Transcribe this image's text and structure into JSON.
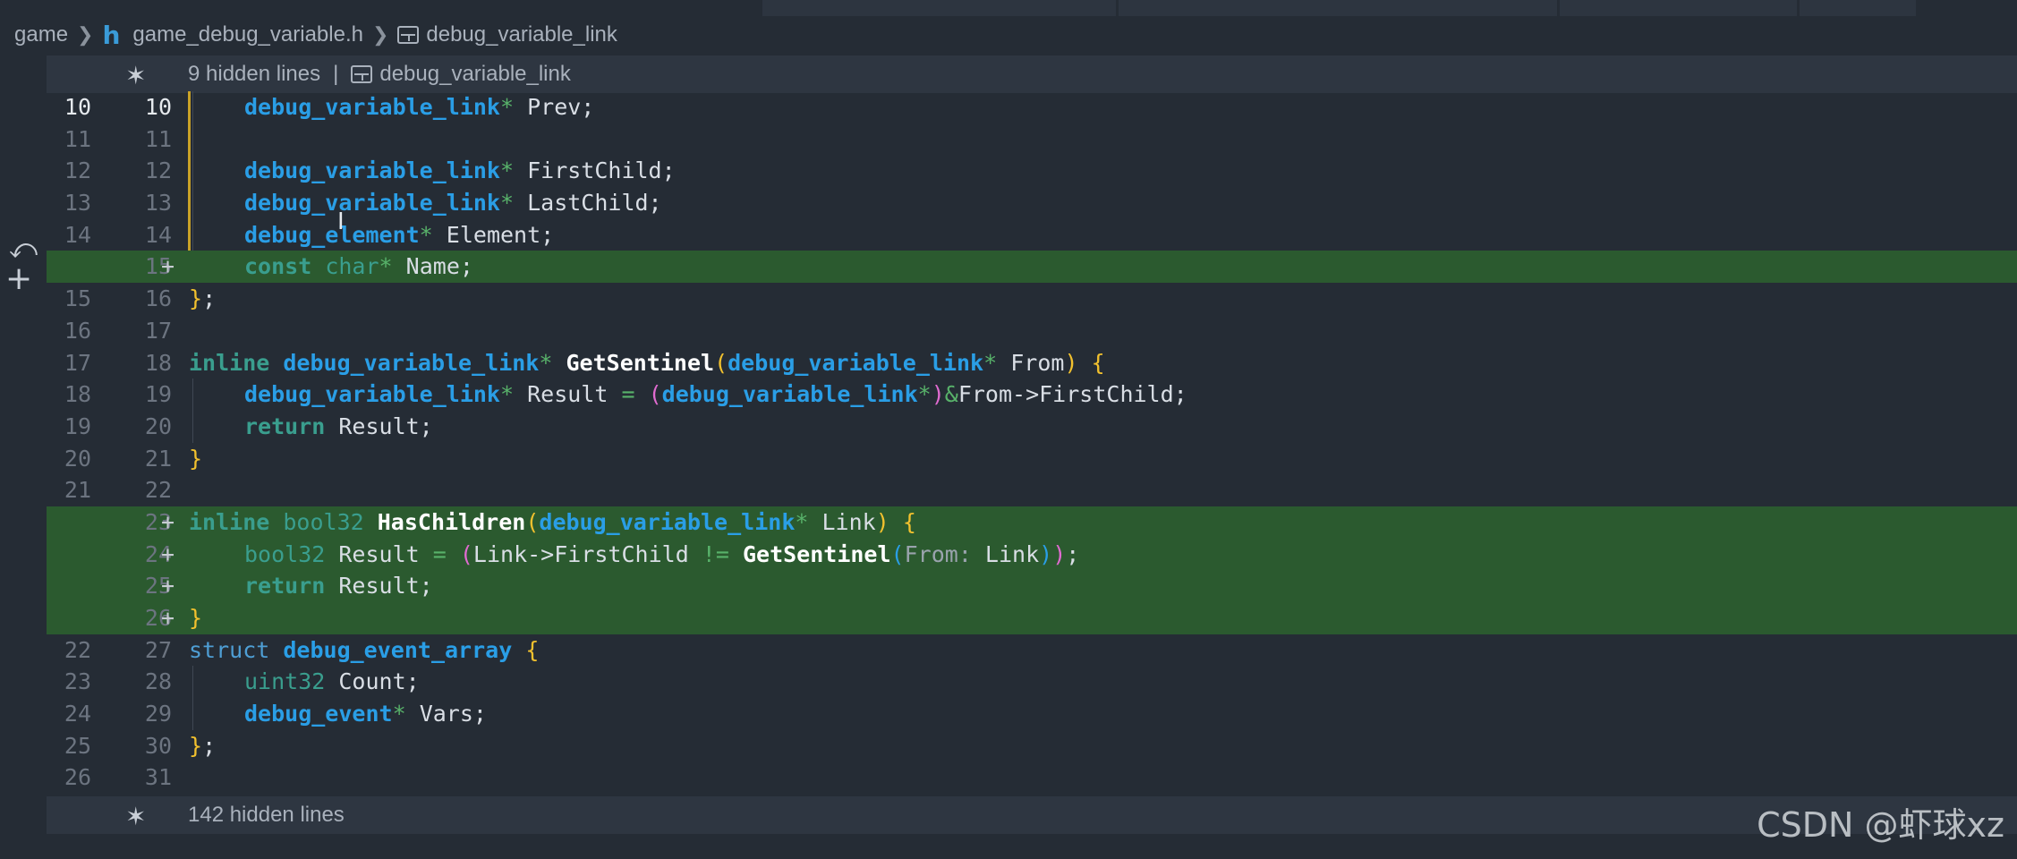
{
  "breadcrumb": {
    "folder": "game",
    "file_icon": "h",
    "file": "game_debug_variable.h",
    "symbol": "debug_variable_link"
  },
  "hidden_top": {
    "label": "9 hidden lines",
    "separator": "|",
    "symbol": "debug_variable_link"
  },
  "hidden_bottom": {
    "label": "142 hidden lines"
  },
  "lines": [
    {
      "old": "10",
      "new": "10",
      "plus": "",
      "added": false,
      "indent": 1,
      "changed": true,
      "active": true,
      "tokens": [
        [
          "ty",
          "debug_variable_link"
        ],
        [
          "op",
          "*"
        ],
        [
          "id",
          " Prev;"
        ]
      ]
    },
    {
      "old": "11",
      "new": "11",
      "plus": "",
      "added": false,
      "indent": 1,
      "changed": true,
      "tokens": []
    },
    {
      "old": "12",
      "new": "12",
      "plus": "",
      "added": false,
      "indent": 1,
      "changed": true,
      "tokens": [
        [
          "ty",
          "debug_variable_link"
        ],
        [
          "op",
          "*"
        ],
        [
          "id",
          " FirstChild;"
        ]
      ]
    },
    {
      "old": "13",
      "new": "13",
      "plus": "",
      "added": false,
      "indent": 1,
      "changed": true,
      "tokens": [
        [
          "ty",
          "debug_variable_link"
        ],
        [
          "op",
          "*"
        ],
        [
          "id",
          " LastChild;"
        ]
      ]
    },
    {
      "old": "14",
      "new": "14",
      "plus": "",
      "added": false,
      "indent": 1,
      "changed": true,
      "tokens": [
        [
          "ty",
          "debug_element"
        ],
        [
          "op",
          "*"
        ],
        [
          "id",
          " Element;"
        ]
      ]
    },
    {
      "old": "",
      "new": "15",
      "plus": "+",
      "added": true,
      "indent": 1,
      "tokens": [
        [
          "kw",
          "const"
        ],
        [
          "id",
          " "
        ],
        [
          "kw2",
          "char"
        ],
        [
          "op",
          "*"
        ],
        [
          "id",
          " Name;"
        ]
      ]
    },
    {
      "old": "15",
      "new": "16",
      "plus": "",
      "added": false,
      "indent": 0,
      "tokens": [
        [
          "br1",
          "}"
        ],
        [
          "id",
          ";"
        ]
      ]
    },
    {
      "old": "16",
      "new": "17",
      "plus": "",
      "added": false,
      "indent": 0,
      "tokens": []
    },
    {
      "old": "17",
      "new": "18",
      "plus": "",
      "added": false,
      "indent": 0,
      "tokens": [
        [
          "kw",
          "inline"
        ],
        [
          "id",
          " "
        ],
        [
          "ty",
          "debug_variable_link"
        ],
        [
          "op",
          "*"
        ],
        [
          "id",
          " "
        ],
        [
          "fn",
          "GetSentinel"
        ],
        [
          "br1",
          "("
        ],
        [
          "ty",
          "debug_variable_link"
        ],
        [
          "op",
          "*"
        ],
        [
          "id",
          " From"
        ],
        [
          "br1",
          ")"
        ],
        [
          "id",
          " "
        ],
        [
          "br1",
          "{"
        ]
      ]
    },
    {
      "old": "18",
      "new": "19",
      "plus": "",
      "added": false,
      "indent": 1,
      "tokens": [
        [
          "ty",
          "debug_variable_link"
        ],
        [
          "op",
          "*"
        ],
        [
          "id",
          " Result "
        ],
        [
          "op",
          "="
        ],
        [
          "id",
          " "
        ],
        [
          "br2",
          "("
        ],
        [
          "ty",
          "debug_variable_link"
        ],
        [
          "op",
          "*"
        ],
        [
          "br2",
          ")"
        ],
        [
          "op",
          "&"
        ],
        [
          "id",
          "From->FirstChild;"
        ]
      ]
    },
    {
      "old": "19",
      "new": "20",
      "plus": "",
      "added": false,
      "indent": 1,
      "tokens": [
        [
          "kw",
          "return"
        ],
        [
          "id",
          " Result;"
        ]
      ]
    },
    {
      "old": "20",
      "new": "21",
      "plus": "",
      "added": false,
      "indent": 0,
      "tokens": [
        [
          "br1",
          "}"
        ]
      ]
    },
    {
      "old": "21",
      "new": "22",
      "plus": "",
      "added": false,
      "indent": 0,
      "tokens": []
    },
    {
      "old": "",
      "new": "23",
      "plus": "+",
      "added": true,
      "indent": 0,
      "tokens": [
        [
          "kw",
          "inline"
        ],
        [
          "id",
          " "
        ],
        [
          "kw2",
          "bool32"
        ],
        [
          "id",
          " "
        ],
        [
          "fn",
          "HasChildren"
        ],
        [
          "br1",
          "("
        ],
        [
          "ty",
          "debug_variable_link"
        ],
        [
          "op",
          "*"
        ],
        [
          "id",
          " Link"
        ],
        [
          "br1",
          ")"
        ],
        [
          "id",
          " "
        ],
        [
          "br1",
          "{"
        ]
      ]
    },
    {
      "old": "",
      "new": "24",
      "plus": "+",
      "added": true,
      "indent": 1,
      "tokens": [
        [
          "kw2",
          "bool32"
        ],
        [
          "id",
          " Result "
        ],
        [
          "op",
          "="
        ],
        [
          "id",
          " "
        ],
        [
          "br2",
          "("
        ],
        [
          "id",
          "Link->FirstChild "
        ],
        [
          "op",
          "!="
        ],
        [
          "id",
          " "
        ],
        [
          "fn",
          "GetSentinel"
        ],
        [
          "br3",
          "("
        ],
        [
          "hint",
          "From:"
        ],
        [
          "id",
          " Link"
        ],
        [
          "br3",
          ")"
        ],
        [
          "br2",
          ")"
        ],
        [
          "id",
          ";"
        ]
      ]
    },
    {
      "old": "",
      "new": "25",
      "plus": "+",
      "added": true,
      "indent": 1,
      "tokens": [
        [
          "kw",
          "return"
        ],
        [
          "id",
          " Result;"
        ]
      ]
    },
    {
      "old": "",
      "new": "26",
      "plus": "+",
      "added": true,
      "indent": 0,
      "tokens": [
        [
          "br1",
          "}"
        ]
      ]
    },
    {
      "old": "22",
      "new": "27",
      "plus": "",
      "added": false,
      "indent": 0,
      "tokens": [
        [
          "strkw",
          "struct"
        ],
        [
          "id",
          " "
        ],
        [
          "ty",
          "debug_event_array"
        ],
        [
          "id",
          " "
        ],
        [
          "br1",
          "{"
        ]
      ]
    },
    {
      "old": "23",
      "new": "28",
      "plus": "",
      "added": false,
      "indent": 1,
      "tokens": [
        [
          "kw2",
          "uint32"
        ],
        [
          "id",
          " Count;"
        ]
      ]
    },
    {
      "old": "24",
      "new": "29",
      "plus": "",
      "added": false,
      "indent": 1,
      "tokens": [
        [
          "ty",
          "debug_event"
        ],
        [
          "op",
          "*"
        ],
        [
          "id",
          " Vars;"
        ]
      ]
    },
    {
      "old": "25",
      "new": "30",
      "plus": "",
      "added": false,
      "indent": 0,
      "tokens": [
        [
          "br1",
          "}"
        ],
        [
          "id",
          ";"
        ]
      ]
    },
    {
      "old": "26",
      "new": "31",
      "plus": "",
      "added": false,
      "indent": 0,
      "tokens": []
    }
  ],
  "icons": {
    "file_type": "h-file-icon",
    "struct": "struct-icon",
    "expand": "unfold-icon",
    "revert": "revert-icon",
    "cursor": "text-cursor-icon"
  },
  "watermark": "CSDN @虾球xz",
  "colors": {
    "background": "#252c35",
    "added_line": "#2b5a2f",
    "change_bar": "#c9a227",
    "type": "#2a9ee6",
    "keyword": "#3a9e8e"
  }
}
